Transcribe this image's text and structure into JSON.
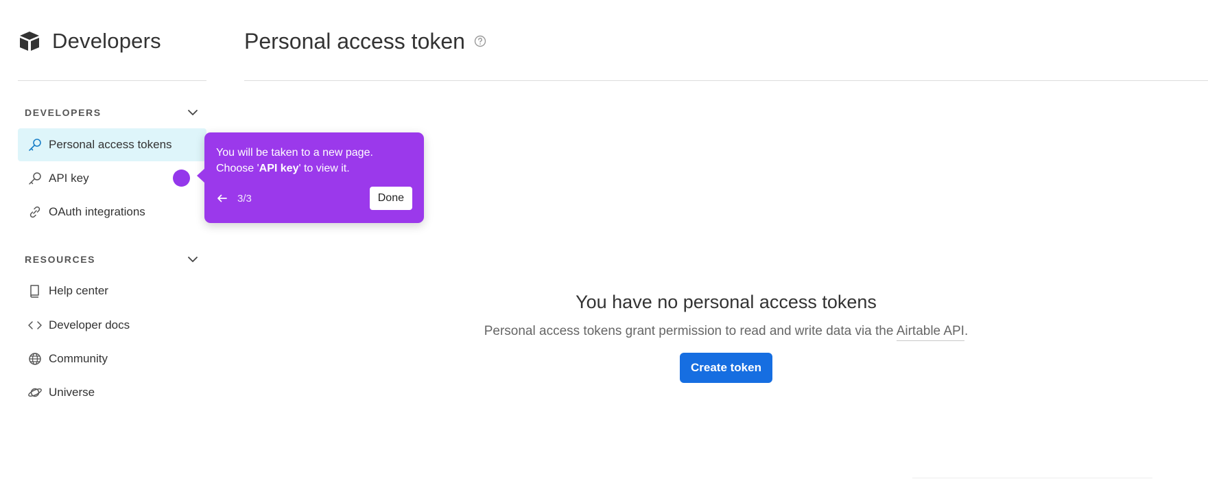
{
  "sidebar": {
    "brand_title": "Developers",
    "sections": [
      {
        "label": "DEVELOPERS",
        "items": [
          {
            "label": "Personal access tokens",
            "icon": "key-icon",
            "active": true
          },
          {
            "label": "API key",
            "icon": "key-icon"
          },
          {
            "label": "OAuth integrations",
            "icon": "link-icon"
          }
        ]
      },
      {
        "label": "RESOURCES",
        "items": [
          {
            "label": "Help center",
            "icon": "book-icon"
          },
          {
            "label": "Developer docs",
            "icon": "code-icon"
          },
          {
            "label": "Community",
            "icon": "globe-icon"
          },
          {
            "label": "Universe",
            "icon": "planet-icon"
          }
        ]
      }
    ]
  },
  "main": {
    "title": "Personal access token",
    "empty_state": {
      "title": "You have no personal access tokens",
      "description_prefix": "Personal access tokens grant permission to read and write data via the ",
      "description_link": "Airtable API",
      "description_suffix": ".",
      "button_label": "Create token"
    }
  },
  "tooltip": {
    "line1": "You will be taken to a new page.",
    "line2_prefix": "Choose '",
    "line2_bold": "API key",
    "line2_suffix": "' to view it.",
    "step": "3/3",
    "done_label": "Done"
  },
  "colors": {
    "accent_blue": "#166ee1",
    "active_bg": "#def5fa",
    "tooltip_purple": "#9b39eb"
  }
}
